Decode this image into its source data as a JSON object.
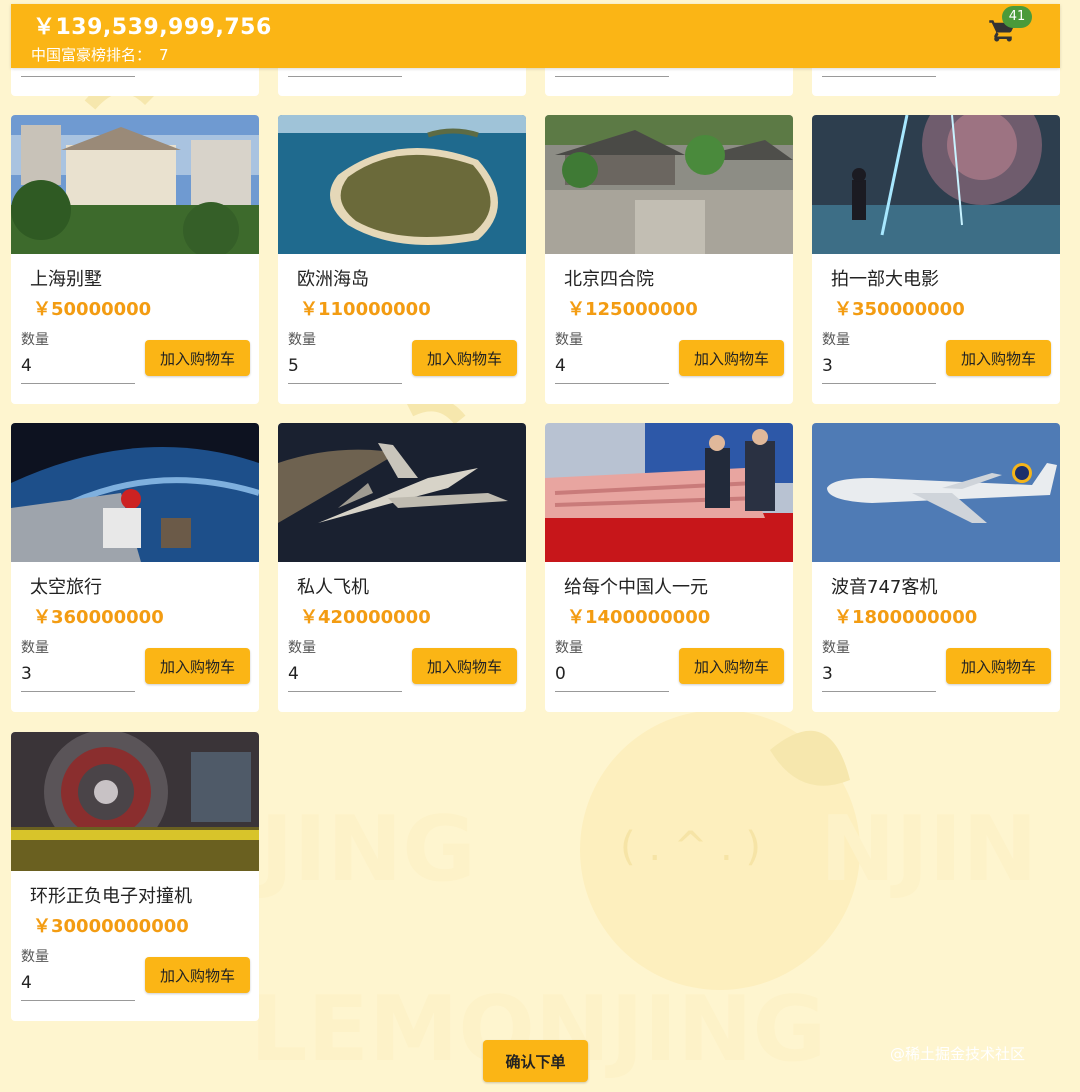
{
  "header": {
    "balance": "￥139,539,999,756",
    "rank_label": "中国富豪榜排名：",
    "rank_value": "7",
    "cart_count": "41",
    "cart_icon": "cart-icon"
  },
  "colors": {
    "accent": "#fbb515",
    "price": "#f39c12",
    "badge": "#4a9a3a",
    "background": "#fef5cf"
  },
  "products": [
    {
      "name": "上海别墅",
      "price": "￥50000000",
      "qty_label": "数量",
      "qty": "4",
      "button": "加入购物车",
      "image": "villa-photo"
    },
    {
      "name": "欧洲海岛",
      "price": "￥110000000",
      "qty_label": "数量",
      "qty": "5",
      "button": "加入购物车",
      "image": "island-photo"
    },
    {
      "name": "北京四合院",
      "price": "￥125000000",
      "qty_label": "数量",
      "qty": "4",
      "button": "加入购物车",
      "image": "courtyard-photo"
    },
    {
      "name": "拍一部大电影",
      "price": "￥350000000",
      "qty_label": "数量",
      "qty": "3",
      "button": "加入购物车",
      "image": "movie-photo"
    },
    {
      "name": "太空旅行",
      "price": "￥360000000",
      "qty_label": "数量",
      "qty": "3",
      "button": "加入购物车",
      "image": "space-photo"
    },
    {
      "name": "私人飞机",
      "price": "￥420000000",
      "qty_label": "数量",
      "qty": "4",
      "button": "加入购物车",
      "image": "jet-photo"
    },
    {
      "name": "给每个中国人一元",
      "price": "￥1400000000",
      "qty_label": "数量",
      "qty": "0",
      "button": "加入购物车",
      "image": "cash-photo"
    },
    {
      "name": "波音747客机",
      "price": "￥1800000000",
      "qty_label": "数量",
      "qty": "3",
      "button": "加入购物车",
      "image": "boeing-photo"
    },
    {
      "name": "环形正负电子对撞机",
      "price": "￥30000000000",
      "qty_label": "数量",
      "qty": "4",
      "button": "加入购物车",
      "image": "collider-photo"
    }
  ],
  "footer": {
    "confirm": "确认下单",
    "credit": "@稀土掘金技术社区"
  }
}
